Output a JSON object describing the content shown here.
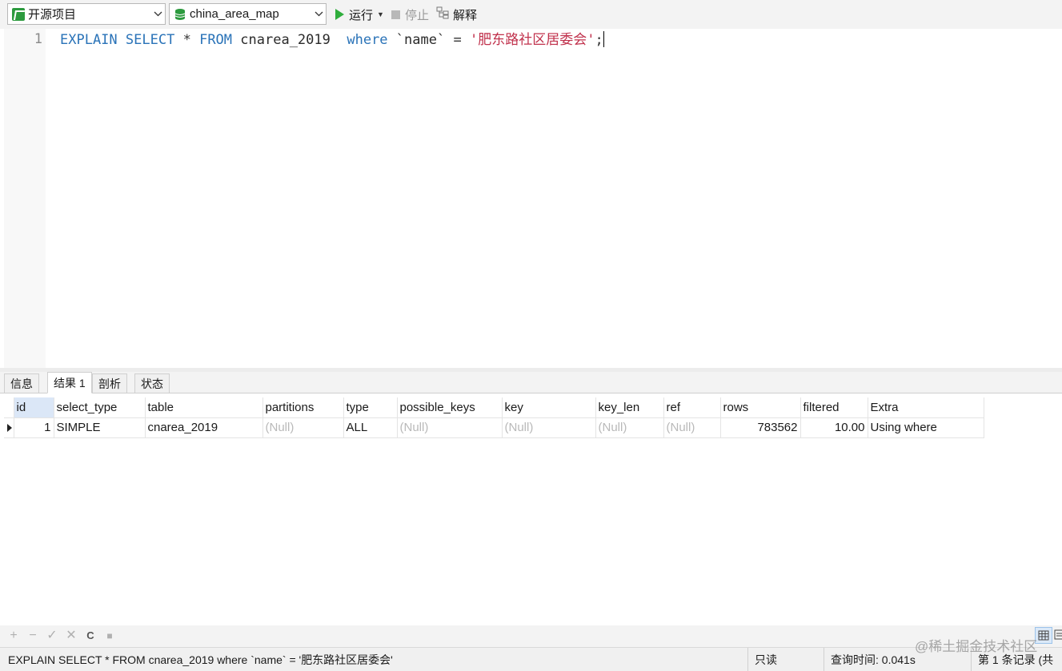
{
  "toolbar": {
    "connection": "开源项目",
    "database": "china_area_map",
    "run_label": "运行",
    "stop_label": "停止",
    "explain_label": "解释"
  },
  "editor": {
    "line_number": "1",
    "tokens": {
      "explain": "EXPLAIN",
      "select": "SELECT",
      "star": "*",
      "from": "FROM",
      "table": "cnarea_2019",
      "where": "where",
      "column": "`name`",
      "eq": "=",
      "value": "'肥东路社区居委会'",
      "semicolon": ";"
    }
  },
  "result_tabs": [
    {
      "label": "信息"
    },
    {
      "label": "结果 1"
    },
    {
      "label": "剖析"
    },
    {
      "label": "状态"
    }
  ],
  "grid": {
    "columns": [
      "id",
      "select_type",
      "table",
      "partitions",
      "type",
      "possible_keys",
      "key",
      "key_len",
      "ref",
      "rows",
      "filtered",
      "Extra"
    ],
    "row": {
      "id": "1",
      "select_type": "SIMPLE",
      "table": "cnarea_2019",
      "partitions": "(Null)",
      "type": "ALL",
      "possible_keys": "(Null)",
      "key": "(Null)",
      "key_len": "(Null)",
      "ref": "(Null)",
      "rows": "783562",
      "filtered": "10.00",
      "Extra": "Using where"
    }
  },
  "gridbar": {
    "add": "+",
    "remove": "−",
    "apply": "✓",
    "discard": "✕",
    "refresh": "C",
    "stop": "■"
  },
  "statusbar": {
    "sql": "EXPLAIN SELECT * FROM cnarea_2019  where `name` = '肥东路社区居委会'",
    "mode": "只读",
    "query_time": "查询时间: 0.041s",
    "record": "第 1 条记录  (共"
  },
  "watermark": "@稀土掘金技术社区",
  "colors": {
    "keyword": "#2a73b8",
    "string": "#c0304b",
    "run": "#2fae3c",
    "null": "#b9b9b9"
  }
}
